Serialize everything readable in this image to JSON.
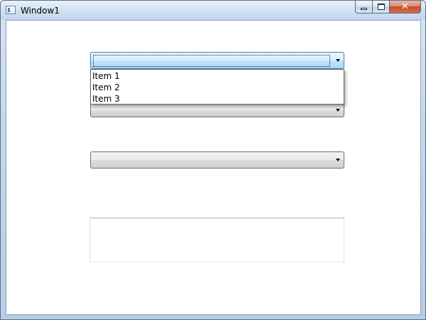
{
  "window": {
    "title": "Window1"
  },
  "combo1": {
    "selected": "",
    "is_open": true,
    "options": [
      "Item 1",
      "Item 2",
      "Item 3"
    ]
  },
  "combo2": {
    "selected": ""
  },
  "combo3": {
    "selected": ""
  },
  "textbox": {
    "value": ""
  },
  "colors": {
    "focus_border": "#3c7fb1",
    "focus_fill": "#bee6fd",
    "close_button": "#c24a28"
  },
  "icons": {
    "app": "window-icon",
    "minimize": "minimize-icon",
    "maximize": "maximize-icon",
    "close": "close-icon",
    "dropdown_arrow": "dropdown-arrow-icon"
  }
}
